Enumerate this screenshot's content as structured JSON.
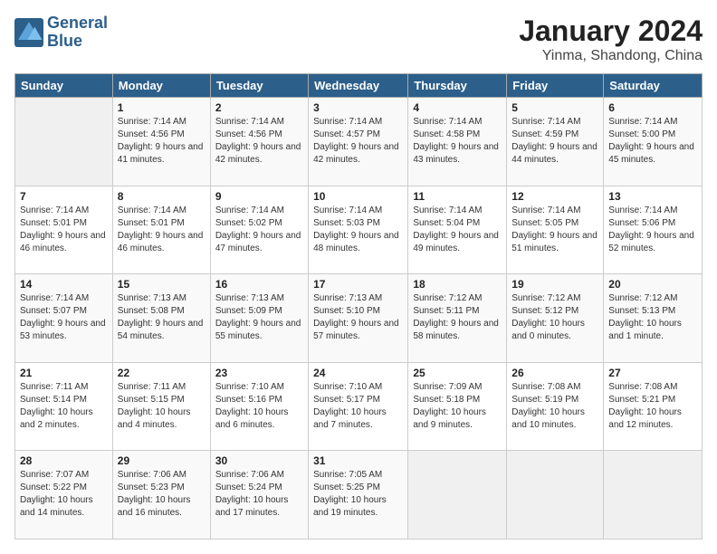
{
  "logo": {
    "line1": "General",
    "line2": "Blue"
  },
  "title": "January 2024",
  "subtitle": "Yinma, Shandong, China",
  "weekdays": [
    "Sunday",
    "Monday",
    "Tuesday",
    "Wednesday",
    "Thursday",
    "Friday",
    "Saturday"
  ],
  "weeks": [
    [
      {
        "day": "",
        "empty": true
      },
      {
        "day": "1",
        "sunrise": "7:14 AM",
        "sunset": "4:56 PM",
        "daylight": "9 hours and 41 minutes."
      },
      {
        "day": "2",
        "sunrise": "7:14 AM",
        "sunset": "4:56 PM",
        "daylight": "9 hours and 42 minutes."
      },
      {
        "day": "3",
        "sunrise": "7:14 AM",
        "sunset": "4:57 PM",
        "daylight": "9 hours and 42 minutes."
      },
      {
        "day": "4",
        "sunrise": "7:14 AM",
        "sunset": "4:58 PM",
        "daylight": "9 hours and 43 minutes."
      },
      {
        "day": "5",
        "sunrise": "7:14 AM",
        "sunset": "4:59 PM",
        "daylight": "9 hours and 44 minutes."
      },
      {
        "day": "6",
        "sunrise": "7:14 AM",
        "sunset": "5:00 PM",
        "daylight": "9 hours and 45 minutes."
      }
    ],
    [
      {
        "day": "7",
        "sunrise": "7:14 AM",
        "sunset": "5:01 PM",
        "daylight": "9 hours and 46 minutes."
      },
      {
        "day": "8",
        "sunrise": "7:14 AM",
        "sunset": "5:01 PM",
        "daylight": "9 hours and 46 minutes."
      },
      {
        "day": "9",
        "sunrise": "7:14 AM",
        "sunset": "5:02 PM",
        "daylight": "9 hours and 47 minutes."
      },
      {
        "day": "10",
        "sunrise": "7:14 AM",
        "sunset": "5:03 PM",
        "daylight": "9 hours and 48 minutes."
      },
      {
        "day": "11",
        "sunrise": "7:14 AM",
        "sunset": "5:04 PM",
        "daylight": "9 hours and 49 minutes."
      },
      {
        "day": "12",
        "sunrise": "7:14 AM",
        "sunset": "5:05 PM",
        "daylight": "9 hours and 51 minutes."
      },
      {
        "day": "13",
        "sunrise": "7:14 AM",
        "sunset": "5:06 PM",
        "daylight": "9 hours and 52 minutes."
      }
    ],
    [
      {
        "day": "14",
        "sunrise": "7:14 AM",
        "sunset": "5:07 PM",
        "daylight": "9 hours and 53 minutes."
      },
      {
        "day": "15",
        "sunrise": "7:13 AM",
        "sunset": "5:08 PM",
        "daylight": "9 hours and 54 minutes."
      },
      {
        "day": "16",
        "sunrise": "7:13 AM",
        "sunset": "5:09 PM",
        "daylight": "9 hours and 55 minutes."
      },
      {
        "day": "17",
        "sunrise": "7:13 AM",
        "sunset": "5:10 PM",
        "daylight": "9 hours and 57 minutes."
      },
      {
        "day": "18",
        "sunrise": "7:12 AM",
        "sunset": "5:11 PM",
        "daylight": "9 hours and 58 minutes."
      },
      {
        "day": "19",
        "sunrise": "7:12 AM",
        "sunset": "5:12 PM",
        "daylight": "10 hours and 0 minutes."
      },
      {
        "day": "20",
        "sunrise": "7:12 AM",
        "sunset": "5:13 PM",
        "daylight": "10 hours and 1 minute."
      }
    ],
    [
      {
        "day": "21",
        "sunrise": "7:11 AM",
        "sunset": "5:14 PM",
        "daylight": "10 hours and 2 minutes."
      },
      {
        "day": "22",
        "sunrise": "7:11 AM",
        "sunset": "5:15 PM",
        "daylight": "10 hours and 4 minutes."
      },
      {
        "day": "23",
        "sunrise": "7:10 AM",
        "sunset": "5:16 PM",
        "daylight": "10 hours and 6 minutes."
      },
      {
        "day": "24",
        "sunrise": "7:10 AM",
        "sunset": "5:17 PM",
        "daylight": "10 hours and 7 minutes."
      },
      {
        "day": "25",
        "sunrise": "7:09 AM",
        "sunset": "5:18 PM",
        "daylight": "10 hours and 9 minutes."
      },
      {
        "day": "26",
        "sunrise": "7:08 AM",
        "sunset": "5:19 PM",
        "daylight": "10 hours and 10 minutes."
      },
      {
        "day": "27",
        "sunrise": "7:08 AM",
        "sunset": "5:21 PM",
        "daylight": "10 hours and 12 minutes."
      }
    ],
    [
      {
        "day": "28",
        "sunrise": "7:07 AM",
        "sunset": "5:22 PM",
        "daylight": "10 hours and 14 minutes."
      },
      {
        "day": "29",
        "sunrise": "7:06 AM",
        "sunset": "5:23 PM",
        "daylight": "10 hours and 16 minutes."
      },
      {
        "day": "30",
        "sunrise": "7:06 AM",
        "sunset": "5:24 PM",
        "daylight": "10 hours and 17 minutes."
      },
      {
        "day": "31",
        "sunrise": "7:05 AM",
        "sunset": "5:25 PM",
        "daylight": "10 hours and 19 minutes."
      },
      {
        "day": "",
        "empty": true
      },
      {
        "day": "",
        "empty": true
      },
      {
        "day": "",
        "empty": true
      }
    ]
  ],
  "labels": {
    "sunrise": "Sunrise:",
    "sunset": "Sunset:",
    "daylight": "Daylight:"
  }
}
